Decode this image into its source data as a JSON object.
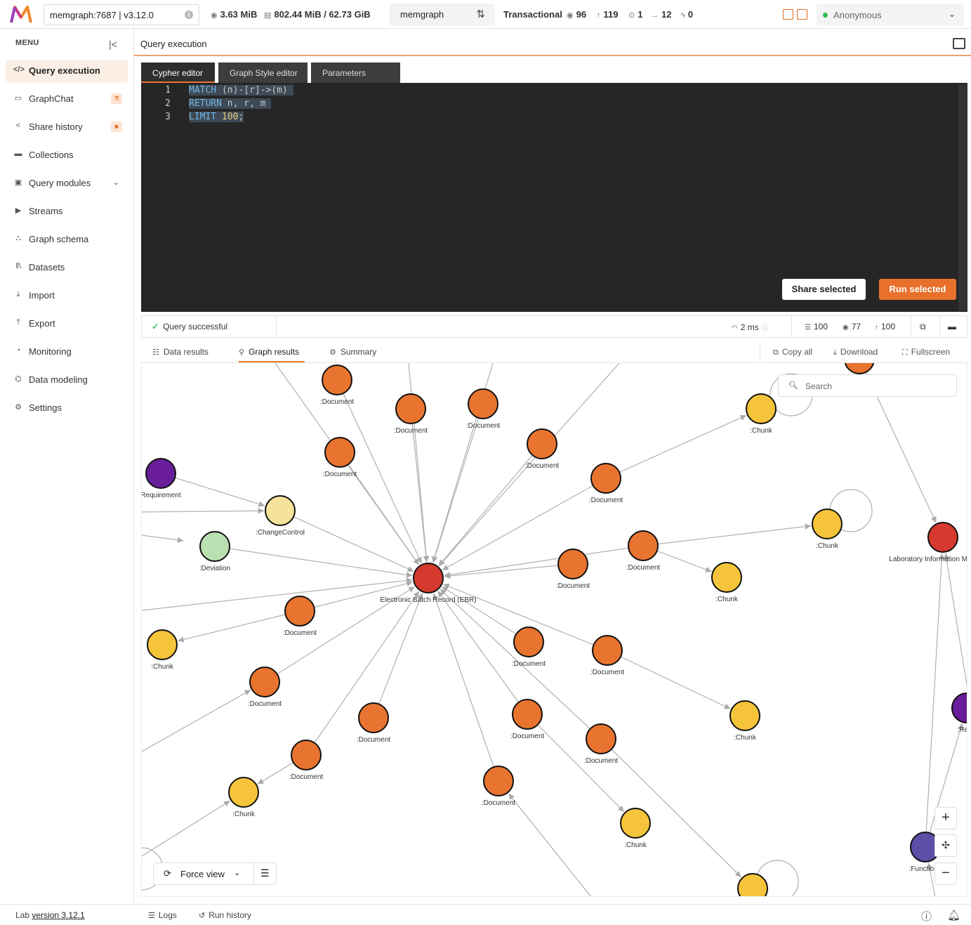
{
  "topbar": {
    "connection": "memgraph:7687 | v3.12.0",
    "memory": "3.63 MiB",
    "storage": "802.44 MiB / 62.73 GiB",
    "database": "memgraph",
    "mode": "Transactional",
    "nodes_count": "96",
    "edges_count": "119",
    "stat3": "1",
    "stat4": "12",
    "stat5": "0",
    "user": "Anonymous"
  },
  "sidebar": {
    "title": "MENU",
    "items": [
      {
        "label": "Query execution",
        "icon": "code-icon"
      },
      {
        "label": "GraphChat",
        "icon": "chat-icon"
      },
      {
        "label": "Share history",
        "icon": "share-icon"
      },
      {
        "label": "Collections",
        "icon": "folder-icon"
      },
      {
        "label": "Query modules",
        "icon": "module-icon"
      },
      {
        "label": "Streams",
        "icon": "play-icon"
      },
      {
        "label": "Graph schema",
        "icon": "schema-icon"
      },
      {
        "label": "Datasets",
        "icon": "library-icon"
      },
      {
        "label": "Import",
        "icon": "import-icon"
      },
      {
        "label": "Export",
        "icon": "export-icon"
      },
      {
        "label": "Monitoring",
        "icon": "monitor-icon"
      },
      {
        "label": "Data modeling",
        "icon": "model-icon"
      },
      {
        "label": "Settings",
        "icon": "gear-icon"
      }
    ]
  },
  "main": {
    "title": "Query execution",
    "tabs": [
      "Cypher editor",
      "Graph Style editor",
      "Parameters"
    ],
    "code": {
      "line_numbers": [
        "1",
        "2",
        "3"
      ],
      "line1": {
        "kw": "MATCH",
        "rest": " (n)-[r]->(m) "
      },
      "line2": {
        "kw": "RETURN",
        "rest": " n, r, m "
      },
      "line3": {
        "kw": "LIMIT",
        "num": " 100",
        "end": ";"
      }
    },
    "share_label": "Share selected",
    "run_label": "Run selected"
  },
  "status": {
    "message": "Query successful",
    "time": "2 ms",
    "rows": "100",
    "nodes": "77",
    "edges": "100"
  },
  "results": {
    "tabs": [
      "Data results",
      "Graph results",
      "Summary"
    ],
    "actions": [
      "Copy all",
      "Download",
      "Fullscreen"
    ],
    "search_placeholder": "Search",
    "view_mode": "Force view"
  },
  "graph": {
    "colors": {
      "document": "#e8742f",
      "chunk": "#f5c43a",
      "ebr": "#d63a2f",
      "requirement": "#6a1d9a",
      "changecontrol": "#f7e29b",
      "deviation": "#b9e0b0",
      "functional": "#5b4fa8"
    },
    "nodes": [
      {
        "id": "ebr",
        "label": "Electronic Batch Record (EBR)",
        "type": "ebr"
      },
      {
        "id": "d1",
        "label": ":Document",
        "type": "document"
      },
      {
        "id": "d2",
        "label": ":Document",
        "type": "document"
      },
      {
        "id": "d3",
        "label": ":Document",
        "type": "document"
      },
      {
        "id": "d4",
        "label": ":Document",
        "type": "document"
      },
      {
        "id": "d5",
        "label": ":Document",
        "type": "document"
      },
      {
        "id": "d6",
        "label": ":Document",
        "type": "document"
      },
      {
        "id": "d7",
        "label": ":Document",
        "type": "document"
      },
      {
        "id": "d8",
        "label": ":Document",
        "type": "document"
      },
      {
        "id": "d9",
        "label": ":Document",
        "type": "document"
      },
      {
        "id": "d10",
        "label": ":Document",
        "type": "document"
      },
      {
        "id": "d11",
        "label": ":Document",
        "type": "document"
      },
      {
        "id": "d12",
        "label": ":Document",
        "type": "document"
      },
      {
        "id": "d13",
        "label": ":Document",
        "type": "document"
      },
      {
        "id": "d14",
        "label": ":Document",
        "type": "document"
      },
      {
        "id": "d15",
        "label": ":Document",
        "type": "document"
      },
      {
        "id": "d16",
        "label": ":Document",
        "type": "document"
      },
      {
        "id": "d17",
        "label": ":Document",
        "type": "document"
      },
      {
        "id": "d18",
        "label": ":Document",
        "type": "document"
      },
      {
        "id": "d19",
        "label": "",
        "type": "document"
      },
      {
        "id": "c1",
        "label": ":Chunk",
        "type": "chunk"
      },
      {
        "id": "c2",
        "label": ":Chunk",
        "type": "chunk"
      },
      {
        "id": "c3",
        "label": ":Chunk",
        "type": "chunk"
      },
      {
        "id": "c4",
        "label": ":Chunk",
        "type": "chunk"
      },
      {
        "id": "c5",
        "label": ":Chunk",
        "type": "chunk"
      },
      {
        "id": "c6",
        "label": ":Chunk",
        "type": "chunk"
      },
      {
        "id": "c7",
        "label": ":Chunk",
        "type": "chunk"
      },
      {
        "id": "c8",
        "label": "",
        "type": "chunk"
      },
      {
        "id": "req",
        "label": "Requirement",
        "type": "requirement"
      },
      {
        "id": "req2",
        "label": ":Requ",
        "type": "requirement"
      },
      {
        "id": "cc",
        "label": ":ChangeControl",
        "type": "changecontrol"
      },
      {
        "id": "dev",
        "label": ":Deviation",
        "type": "deviation"
      },
      {
        "id": "lims",
        "label": "Laboratory Information Manageme",
        "type": "ebr"
      },
      {
        "id": "func",
        "label": ":Functiona",
        "type": "functional"
      }
    ]
  },
  "footer": {
    "lab": "Lab",
    "version": "version 3.12.1",
    "logs": "Logs",
    "run_history": "Run history"
  }
}
